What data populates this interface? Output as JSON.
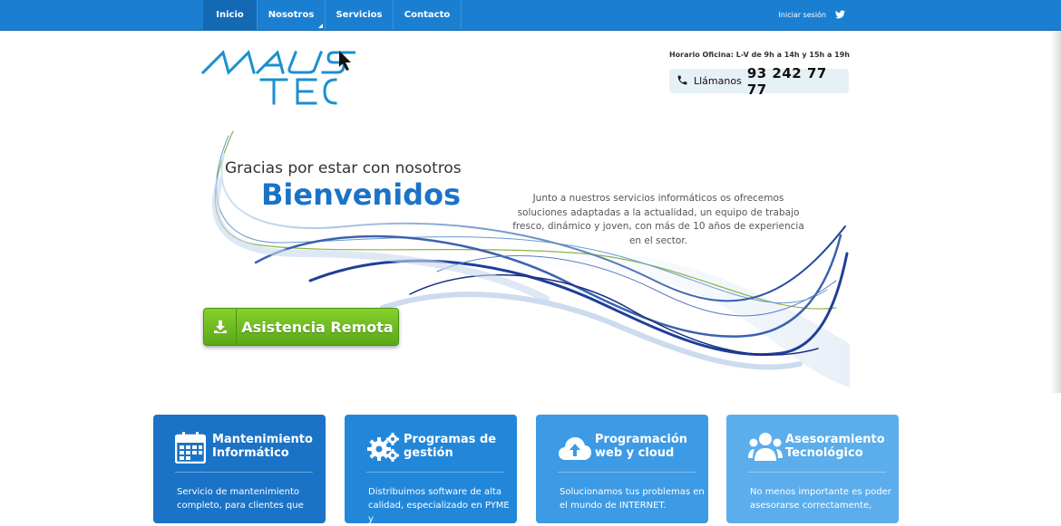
{
  "nav": {
    "items": [
      {
        "label": "Inicio",
        "active": true
      },
      {
        "label": "Nosotros",
        "has_dropdown": true
      },
      {
        "label": "Servicios"
      },
      {
        "label": "Contacto"
      }
    ],
    "login_label": "Iniciar sesión",
    "social_icon": "twitter-icon"
  },
  "header": {
    "logo_top": "MAUS",
    "logo_bottom": "TEC",
    "hours": "Horario Oficina: L-V de 9h a 14h y 15h a 19h",
    "call_label": "Llámanos",
    "phone": "93 242 77 77",
    "phone_icon": "phone-icon"
  },
  "hero": {
    "subtitle": "Gracias por estar con nosotros",
    "title": "Bienvenidos",
    "text": "Junto a nuestros servicios informáticos os ofrecemos soluciones adaptadas a la actualidad, un equipo de trabajo fresco, dinámico y joven, con más de 10 años de experiencia en el sector.",
    "remote_button": "Asistencia Remota",
    "remote_icon": "download-icon"
  },
  "cards": [
    {
      "title": "Mantenimiento Informático",
      "icon": "calendar-icon",
      "text": "Servicio de mantenimiento completo, para clientes que",
      "color": "#1a73c6"
    },
    {
      "title": "Programas de gestión",
      "icon": "gears-icon",
      "text": "Distribuimos software de alta calidad, especializado en PYME y",
      "color": "#2287d9"
    },
    {
      "title": "Programación web y cloud",
      "icon": "cloud-upload-icon",
      "text": "Solucionamos tus problemas en el mundo de INTERNET.",
      "color": "#3d9ae4"
    },
    {
      "title": "Asesoramiento Tecnológico",
      "icon": "users-icon",
      "text": "No menos importante es poder asesorarse correctamente,",
      "color": "#5cadeb"
    }
  ],
  "colors": {
    "nav_bg": "#1b7fd1",
    "accent": "#1a73c6",
    "button_green": "#6bbb1f"
  }
}
